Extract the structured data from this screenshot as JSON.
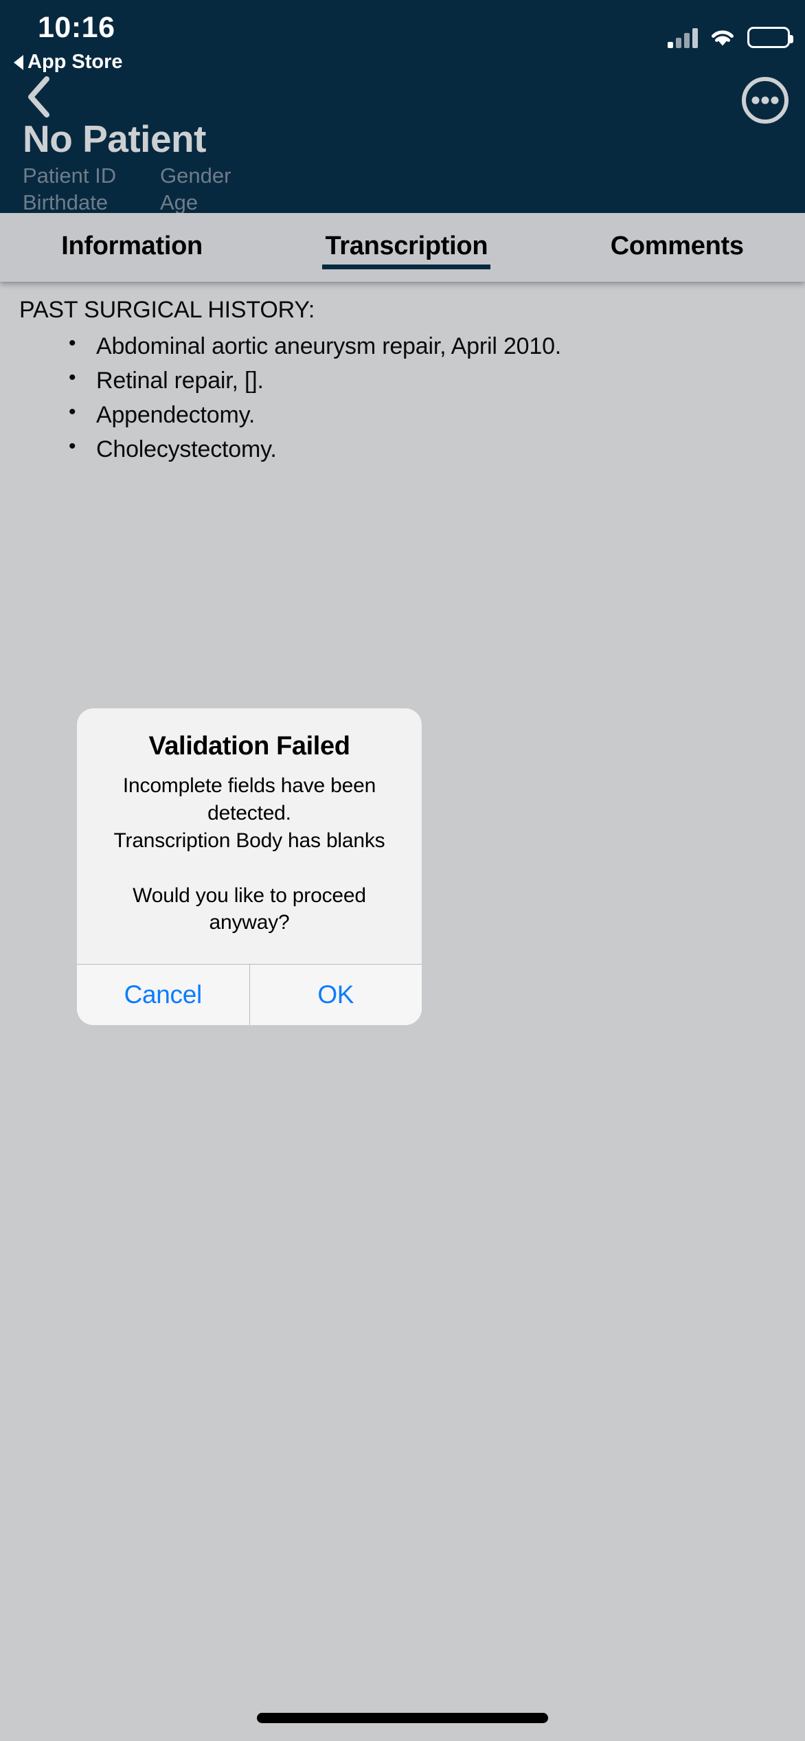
{
  "status_bar": {
    "time": "10:16",
    "return_label": "App Store",
    "icons": {
      "cellular": "signal-bars-icon",
      "wifi": "wifi-icon",
      "battery": "battery-full-icon"
    }
  },
  "nav": {
    "back_icon": "chevron-left-icon",
    "more_icon": "ellipsis-circle-icon"
  },
  "patient": {
    "name": "No Patient",
    "fields": [
      {
        "left": "Patient ID",
        "right": "Gender"
      },
      {
        "left": "Birthdate",
        "right": "Age"
      }
    ]
  },
  "tabs": [
    {
      "label": "Information",
      "active": false
    },
    {
      "label": "Transcription",
      "active": true
    },
    {
      "label": "Comments",
      "active": false
    }
  ],
  "transcription": {
    "heading": "PAST SURGICAL HISTORY:",
    "items": [
      "Abdominal aortic aneurysm repair, April 2010.",
      "Retinal repair, [].",
      "Appendectomy.",
      "Cholecystectomy."
    ]
  },
  "alert": {
    "title": "Validation Failed",
    "message": "Incomplete fields have been detected.\nTranscription Body has blanks\n\nWould you like to proceed anyway?",
    "cancel_label": "Cancel",
    "ok_label": "OK"
  },
  "colors": {
    "header_navy": "#072940",
    "tab_bar": "#c4c6c9",
    "content_bg": "#c8cacc",
    "accent_blue": "#0a7cff",
    "muted_text": "#6e7d89",
    "patient_name": "#cdd0d2"
  }
}
